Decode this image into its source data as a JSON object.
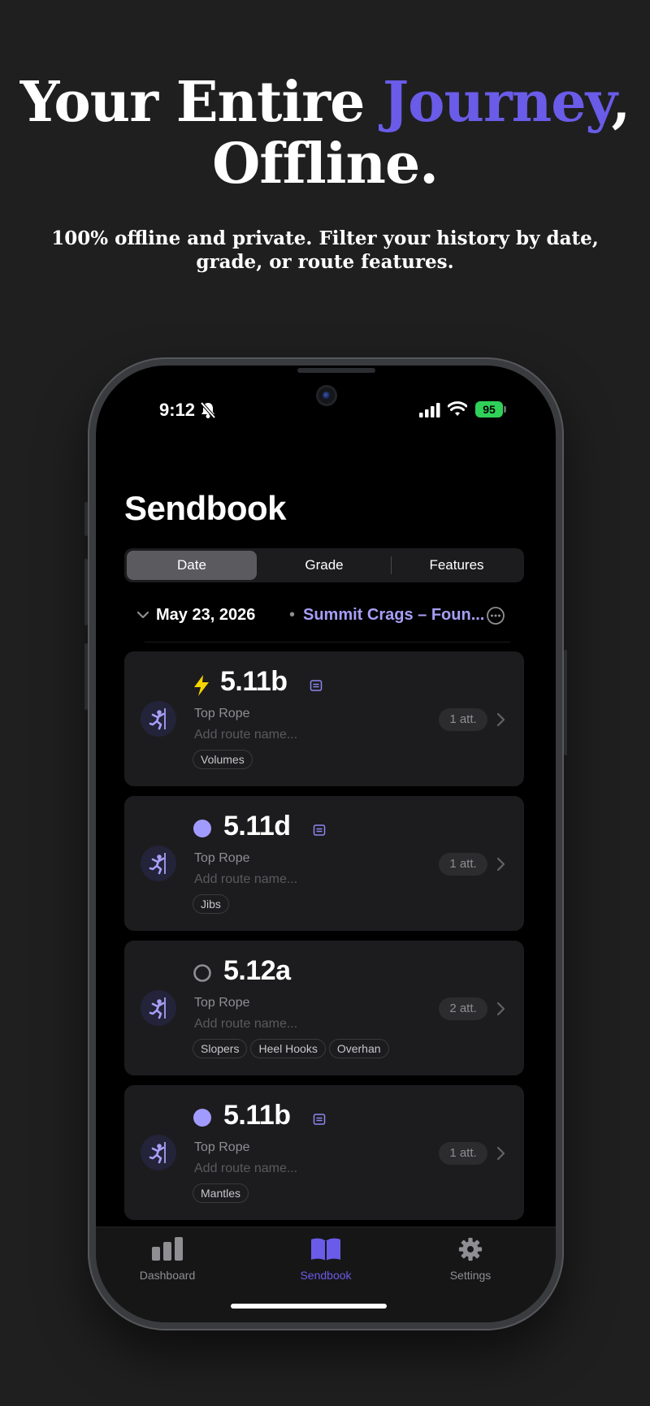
{
  "promo": {
    "headline_part1": "Your Entire ",
    "headline_accent": "Journey",
    "headline_part2": ",",
    "headline_line2": "Offline.",
    "subheadline": "100% offline and private. Filter your history by date, grade, or route features."
  },
  "status_bar": {
    "time": "9:12",
    "battery": "95"
  },
  "app": {
    "title": "Sendbook",
    "segments": [
      {
        "label": "Date",
        "active": true
      },
      {
        "label": "Grade",
        "active": false
      },
      {
        "label": "Features",
        "active": false
      }
    ],
    "session": {
      "date": "May 23, 2026",
      "separator": "•",
      "location": "Summit Crags – Foun..."
    },
    "climbs": [
      {
        "grade": "5.11b",
        "status_icon": "lightning-icon",
        "has_note": true,
        "style": "Top Rope",
        "route_name_placeholder": "Add route name...",
        "tags": [
          "Volumes"
        ],
        "attempts": "1 att."
      },
      {
        "grade": "5.11d",
        "status_icon": "filled-circle-icon",
        "has_note": true,
        "style": "Top Rope",
        "route_name_placeholder": "Add route name...",
        "tags": [
          "Jibs"
        ],
        "attempts": "1 att."
      },
      {
        "grade": "5.12a",
        "status_icon": "empty-circle-icon",
        "has_note": false,
        "style": "Top Rope",
        "route_name_placeholder": "Add route name...",
        "tags": [
          "Slopers",
          "Heel Hooks",
          "Overhan"
        ],
        "attempts": "2 att."
      },
      {
        "grade": "5.11b",
        "status_icon": "filled-circle-icon",
        "has_note": true,
        "style": "Top Rope",
        "route_name_placeholder": "Add route name...",
        "tags": [
          "Mantles"
        ],
        "attempts": "1 att."
      }
    ],
    "tabbar": [
      {
        "label": "Dashboard",
        "icon": "bar-chart-icon",
        "active": false
      },
      {
        "label": "Sendbook",
        "icon": "book-icon",
        "active": true
      },
      {
        "label": "Settings",
        "icon": "gear-icon",
        "active": false
      }
    ]
  },
  "colors": {
    "accent": "#6a5ce8",
    "location": "#a79ef6",
    "flash": "#f5d400",
    "send_dot": "#a29bfe",
    "battery": "#30d158"
  }
}
